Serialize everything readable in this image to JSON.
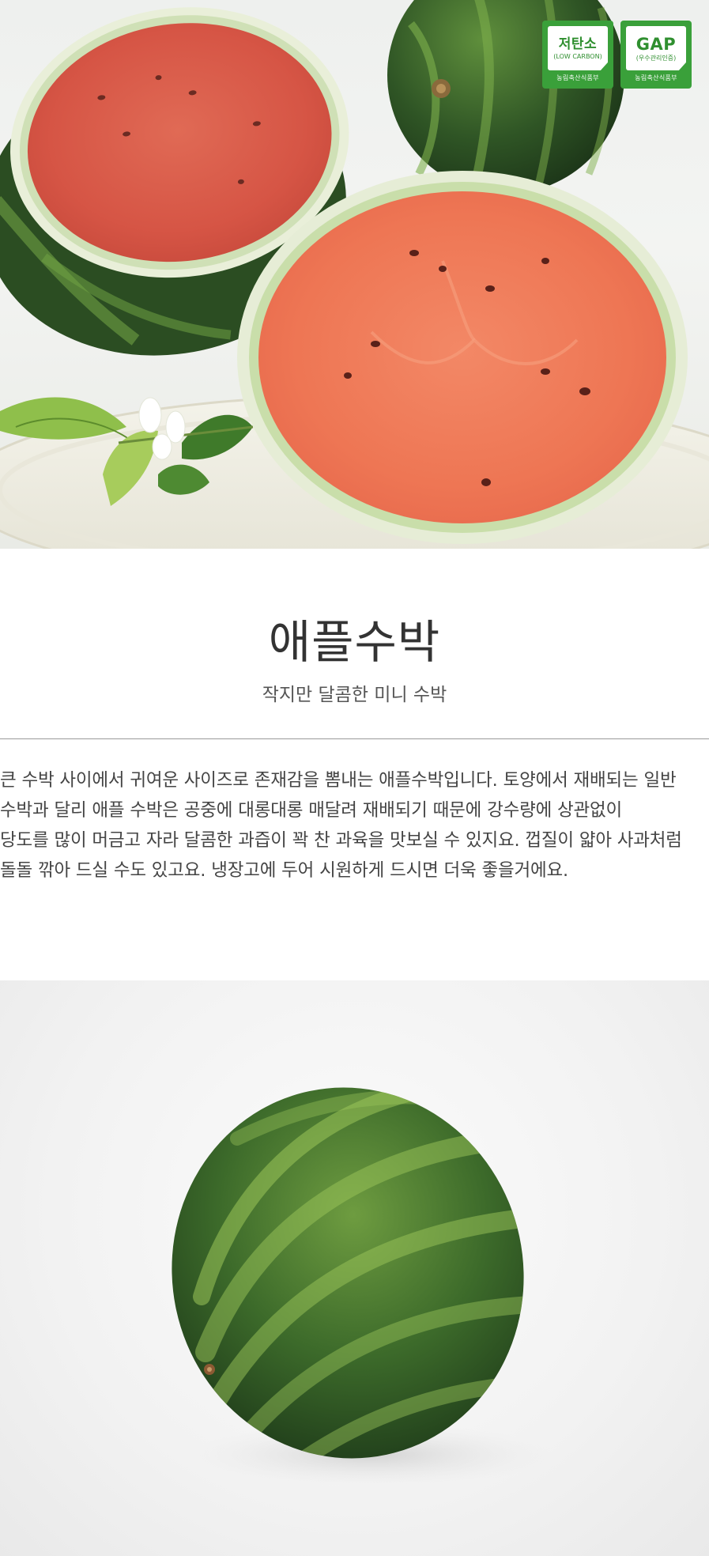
{
  "hero": {
    "badges": [
      {
        "main": "저탄소",
        "sub": "(LOW CARBON)",
        "org": "농림축산식품부"
      },
      {
        "main": "GAP",
        "sub": "(우수관리인증)",
        "org": "농림축산식품부"
      }
    ]
  },
  "product": {
    "title": "애플수박",
    "subtitle": "작지만 달콤한 미니 수박"
  },
  "description": {
    "lines": [
      "큰 수박 사이에서 귀여운 사이즈로 존재감을 뽐내는 애플수박입니다. 토양에서 재배되는 일반",
      "수박과 달리 애플 수박은 공중에 대롱대롱 매달려 재배되기 때문에 강수량에 상관없이",
      "당도를 많이 머금고 자라 달콤한 과즙이 꽉 찬 과육을 맛보실 수 있지요. 껍질이 얇아 사과처럼",
      "돌돌 깎아 드실 수도 있고요. 냉장고에 두어 시원하게 드시면 더욱 좋을거에요."
    ]
  },
  "colors": {
    "badge_green": "#3aa03a",
    "flesh_red": "#e0533c",
    "rind_dark": "#24421f"
  },
  "icons": [
    "low-carbon-certification-badge",
    "gap-certification-badge"
  ]
}
